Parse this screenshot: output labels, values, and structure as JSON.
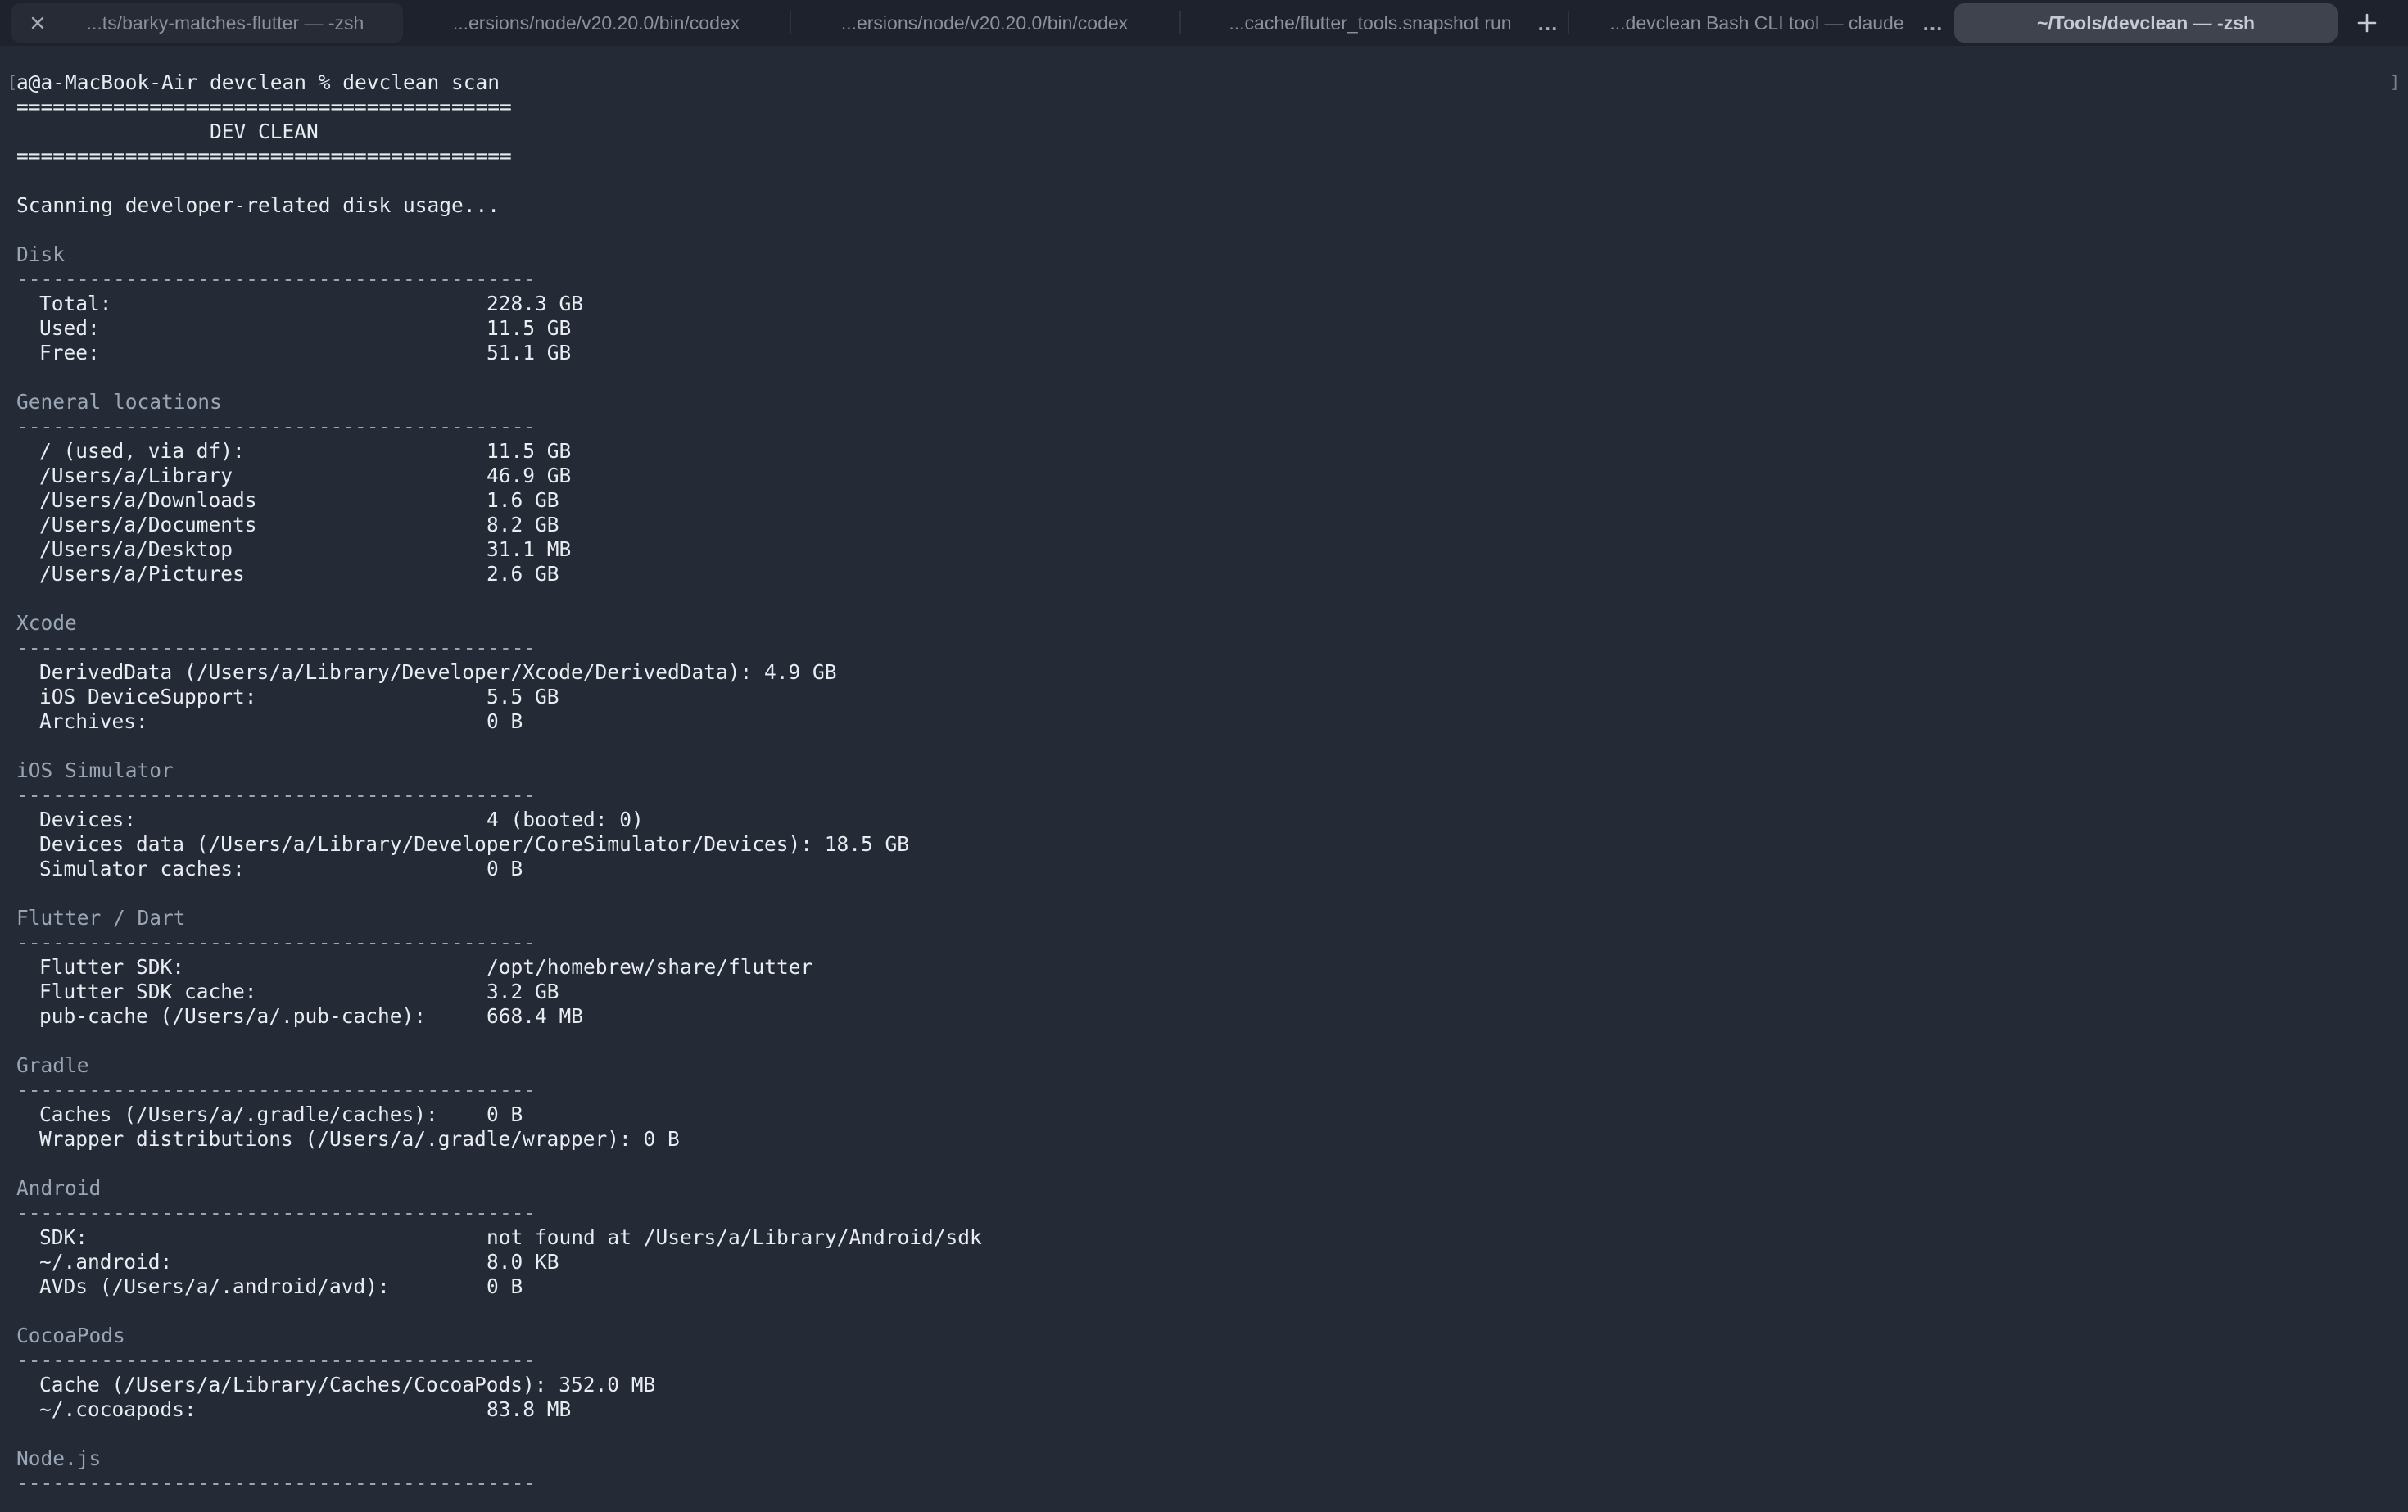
{
  "tabs": [
    {
      "label": "...ts/barky-matches-flutter — -zsh",
      "close_icon": "close-icon"
    },
    {
      "label": "...ersions/node/v20.20.0/bin/codex"
    },
    {
      "label": "...ersions/node/v20.20.0/bin/codex"
    },
    {
      "label": "...cache/flutter_tools.snapshot run"
    },
    {
      "label": "...devclean Bash CLI tool — claude"
    },
    {
      "label": "~/Tools/devclean — -zsh"
    }
  ],
  "tab_more_glyph": "...",
  "new_tab_icon": "plus-icon",
  "terminal": {
    "prompt": "a@a-MacBook-Air devclean % devclean scan",
    "banner_rule": "=========================================",
    "banner_title": "                DEV CLEAN",
    "scanning": "Scanning developer-related disk usage...",
    "section_rule": "-------------------------------------------",
    "sections": [
      {
        "title": "Disk",
        "rows": [
          {
            "label": "Total:",
            "value": "228.3 GB"
          },
          {
            "label": "Used:",
            "value": "11.5 GB"
          },
          {
            "label": "Free:",
            "value": "51.1 GB"
          }
        ]
      },
      {
        "title": "General locations",
        "rows": [
          {
            "label": "/ (used, via df):",
            "value": "11.5 GB"
          },
          {
            "label": "/Users/a/Library",
            "value": "46.9 GB"
          },
          {
            "label": "/Users/a/Downloads",
            "value": "1.6 GB"
          },
          {
            "label": "/Users/a/Documents",
            "value": "8.2 GB"
          },
          {
            "label": "/Users/a/Desktop",
            "value": "31.1 MB"
          },
          {
            "label": "/Users/a/Pictures",
            "value": "2.6 GB"
          }
        ]
      },
      {
        "title": "Xcode",
        "rows": [
          {
            "text": "DerivedData (/Users/a/Library/Developer/Xcode/DerivedData): 4.9 GB"
          },
          {
            "label": "iOS DeviceSupport:",
            "value": "5.5 GB"
          },
          {
            "label": "Archives:",
            "value": "0 B"
          }
        ]
      },
      {
        "title": "iOS Simulator",
        "rows": [
          {
            "label": "Devices:",
            "value": "4 (booted: 0)"
          },
          {
            "text": "Devices data (/Users/a/Library/Developer/CoreSimulator/Devices): 18.5 GB"
          },
          {
            "label": "Simulator caches:",
            "value": "0 B"
          }
        ]
      },
      {
        "title": "Flutter / Dart",
        "rows": [
          {
            "label": "Flutter SDK:",
            "value": "/opt/homebrew/share/flutter"
          },
          {
            "label": "Flutter SDK cache:",
            "value": "3.2 GB"
          },
          {
            "label": "pub-cache (/Users/a/.pub-cache):",
            "value": "668.4 MB"
          }
        ]
      },
      {
        "title": "Gradle",
        "rows": [
          {
            "label": "Caches (/Users/a/.gradle/caches):",
            "value": "0 B"
          },
          {
            "text": "Wrapper distributions (/Users/a/.gradle/wrapper): 0 B"
          }
        ]
      },
      {
        "title": "Android",
        "rows": [
          {
            "label": "SDK:",
            "value": "not found at /Users/a/Library/Android/sdk"
          },
          {
            "label": "~/.android:",
            "value": "8.0 KB"
          },
          {
            "label": "AVDs (/Users/a/.android/avd):",
            "value": "0 B"
          }
        ]
      },
      {
        "title": "CocoaPods",
        "rows": [
          {
            "text": "Cache (/Users/a/Library/Caches/CocoaPods): 352.0 MB"
          },
          {
            "label": "~/.cocoapods:",
            "value": "83.8 MB"
          }
        ]
      },
      {
        "title": "Node.js",
        "rows": []
      }
    ]
  },
  "colors": {
    "background": "#242a36",
    "tabbar": "#1d222c",
    "active_tab": "#3e434d",
    "text": "#e9edf2",
    "section_header": "#9aa6b6"
  }
}
